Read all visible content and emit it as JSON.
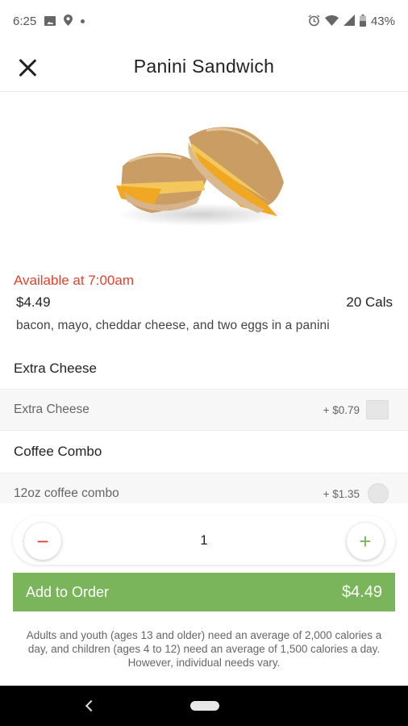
{
  "status_bar": {
    "time": "6:25",
    "battery": "43%",
    "icons": [
      "image-icon",
      "location-icon",
      "notification-dot-icon",
      "alarm-icon",
      "wifi-icon",
      "signal-icon",
      "battery-icon"
    ]
  },
  "header": {
    "title": "Panini Sandwich",
    "close_icon": "close-icon"
  },
  "product": {
    "availability": "Available at 7:00am",
    "price": "$4.49",
    "calories": "20 Cals",
    "description": "bacon, mayo, cheddar cheese, and two eggs in a panini"
  },
  "sections": [
    {
      "title": "Extra Cheese",
      "options": [
        {
          "label": "Extra Cheese",
          "price": "+ $0.79",
          "control": "checkbox"
        }
      ]
    },
    {
      "title": "Coffee Combo",
      "options": [
        {
          "label": "12oz coffee combo",
          "price": "+ $1.35",
          "control": "radio"
        }
      ]
    }
  ],
  "quantity": {
    "minus": "−",
    "value": "1",
    "plus": "+"
  },
  "add_button": {
    "label": "Add to Order",
    "price": "$4.49"
  },
  "disclaimer": "Adults and youth (ages 13 and older) need an average of 2,000 calories a day, and children (ages 4 to 12) need an average of 1,500 calories a day. However, individual needs vary.",
  "colors": {
    "accent_green": "#7ab55c",
    "availability_red": "#e2412c"
  }
}
